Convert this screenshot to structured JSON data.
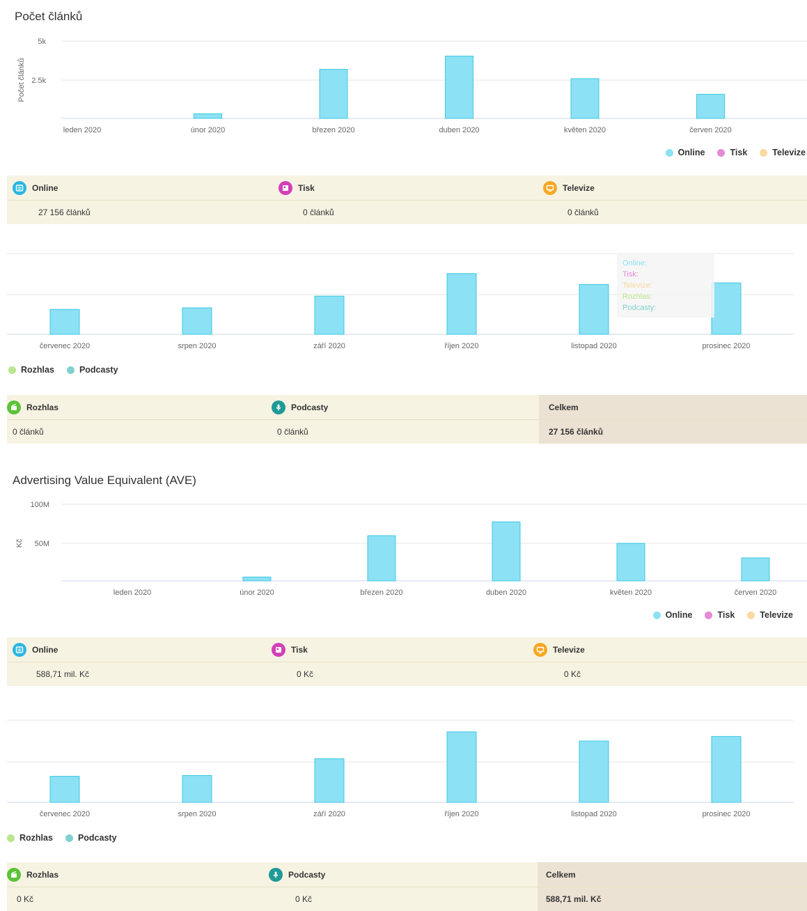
{
  "colors": {
    "online": "#8de1f4",
    "online_stroke": "#3dc8e3",
    "tisk": "#e58ad6",
    "televize": "#fbd9a0",
    "rozhlas": "#b9e68e",
    "podcasty": "#7fd1cf"
  },
  "section1": {
    "title": "Počet článků",
    "legend1": [
      {
        "label": "Online",
        "color": "#8de1f4"
      },
      {
        "label": "Tisk",
        "color": "#e58ad6"
      },
      {
        "label": "Televize",
        "color": "#fbd9a0"
      }
    ],
    "legend2": [
      {
        "label": "Rozhlas",
        "color": "#b9e68e"
      },
      {
        "label": "Podcasty",
        "color": "#7fd1cf"
      }
    ],
    "stats_top": [
      {
        "label": "Online",
        "value": "27 156 článků",
        "icon": "online-icon",
        "icon_color": "#2bb6e3"
      },
      {
        "label": "Tisk",
        "value": "0 článků",
        "icon": "print-icon",
        "icon_color": "#d33fb8"
      },
      {
        "label": "Televize",
        "value": "0 článků",
        "icon": "tv-icon",
        "icon_color": "#f7a824"
      }
    ],
    "stats_bottom": [
      {
        "label": "Rozhlas",
        "value": "0 článků",
        "icon": "radio-icon",
        "icon_color": "#5cc23a"
      },
      {
        "label": "Podcasty",
        "value": "0 článků",
        "icon": "microphone-icon",
        "icon_color": "#1f9a97"
      },
      {
        "label": "Celkem",
        "value": "27 156 článků"
      }
    ],
    "tooltip": [
      "Online:",
      "Tisk:",
      "Televize:",
      "Rozhlas:",
      "Podcasty:"
    ]
  },
  "section2": {
    "title": "Advertising Value Equivalent (AVE)",
    "legend1": [
      {
        "label": "Online",
        "color": "#8de1f4"
      },
      {
        "label": "Tisk",
        "color": "#e58ad6"
      },
      {
        "label": "Televize",
        "color": "#fbd9a0"
      }
    ],
    "legend2": [
      {
        "label": "Rozhlas",
        "color": "#b9e68e"
      },
      {
        "label": "Podcasty",
        "color": "#7fd1cf"
      }
    ],
    "stats_top": [
      {
        "label": "Online",
        "value": "588,71 mil. Kč",
        "icon": "online-icon",
        "icon_color": "#2bb6e3"
      },
      {
        "label": "Tisk",
        "value": "0 Kč",
        "icon": "print-icon",
        "icon_color": "#d33fb8"
      },
      {
        "label": "Televize",
        "value": "0 Kč",
        "icon": "tv-icon",
        "icon_color": "#f7a824"
      }
    ],
    "stats_bottom": [
      {
        "label": "Rozhlas",
        "value": "0 Kč",
        "icon": "radio-icon",
        "icon_color": "#5cc23a"
      },
      {
        "label": "Podcasty",
        "value": "0 Kč",
        "icon": "microphone-icon",
        "icon_color": "#1f9a97"
      },
      {
        "label": "Celkem",
        "value": "588,71 mil. Kč"
      }
    ]
  },
  "chart_data": [
    {
      "type": "bar",
      "ylabel": "Počet článků",
      "yticks": [
        "2.5k",
        "5k"
      ],
      "ylim": [
        0,
        5000
      ],
      "categories": [
        "leden 2020",
        "únor 2020",
        "březen 2020",
        "duben 2020",
        "květen 2020",
        "červen 2020"
      ],
      "series": [
        {
          "name": "Online",
          "values": [
            0,
            300,
            3150,
            4000,
            2550,
            1550
          ]
        }
      ]
    },
    {
      "type": "bar",
      "ylim": [
        0,
        5000
      ],
      "categories": [
        "červenec 2020",
        "srpen 2020",
        "září 2020",
        "říjen 2020",
        "listopad 2020",
        "prosinec 2020"
      ],
      "series": [
        {
          "name": "Online",
          "values": [
            1600,
            1700,
            2450,
            3900,
            3200,
            3300
          ]
        }
      ]
    },
    {
      "type": "bar",
      "ylabel": "Kč",
      "yticks": [
        "50M",
        "100M"
      ],
      "ylim": [
        0,
        100
      ],
      "categories": [
        "leden 2020",
        "únor 2020",
        "březen 2020",
        "duben 2020",
        "květen 2020",
        "červen 2020"
      ],
      "series": [
        {
          "name": "Online",
          "values": [
            0,
            5,
            59,
            77,
            49,
            30
          ]
        }
      ]
    },
    {
      "type": "bar",
      "ylim": [
        0,
        100
      ],
      "categories": [
        "červenec 2020",
        "srpen 2020",
        "září 2020",
        "říjen 2020",
        "listopad 2020",
        "prosinec 2020"
      ],
      "series": [
        {
          "name": "Online",
          "values": [
            34,
            35,
            57,
            92,
            80,
            86
          ]
        }
      ]
    }
  ]
}
